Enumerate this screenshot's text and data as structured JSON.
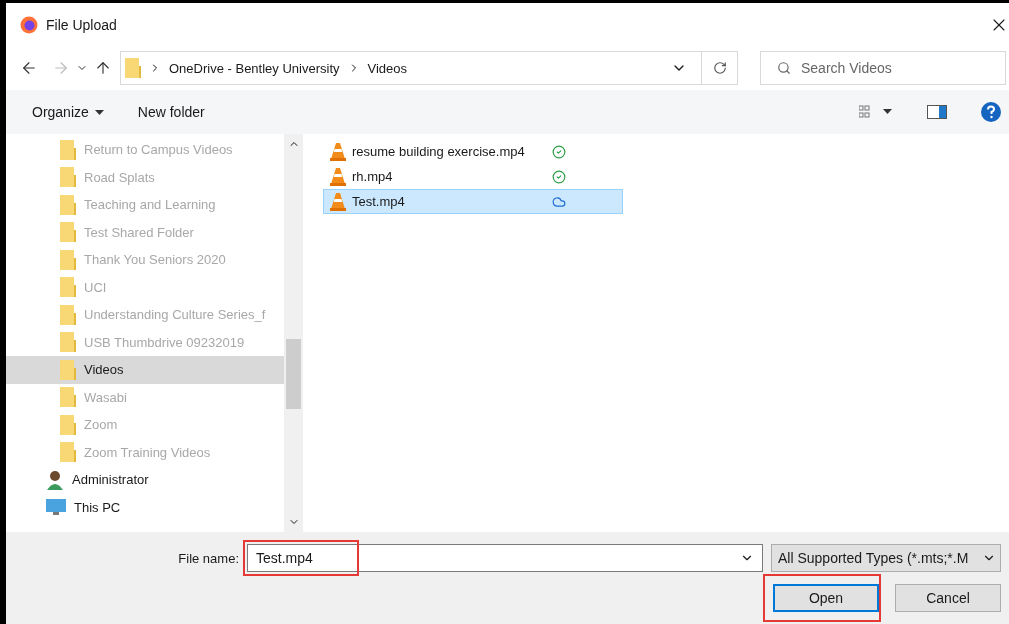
{
  "window": {
    "title": "File Upload"
  },
  "address": {
    "crumbs": [
      "OneDrive - Bentley University",
      "Videos"
    ]
  },
  "search": {
    "placeholder": "Search Videos"
  },
  "toolbar": {
    "organize": "Organize",
    "new_folder": "New folder"
  },
  "sidebar": {
    "items": [
      {
        "label": "Return to Campus Videos",
        "kind": "folder",
        "selected": false,
        "dimmed": true
      },
      {
        "label": "Road Splats",
        "kind": "folder",
        "selected": false,
        "dimmed": true
      },
      {
        "label": "Teaching and Learning",
        "kind": "folder",
        "selected": false,
        "dimmed": true
      },
      {
        "label": "Test Shared Folder",
        "kind": "folder",
        "selected": false,
        "dimmed": true
      },
      {
        "label": "Thank You Seniors 2020",
        "kind": "folder",
        "selected": false,
        "dimmed": true
      },
      {
        "label": "UCI",
        "kind": "folder",
        "selected": false,
        "dimmed": true
      },
      {
        "label": "Understanding Culture Series_f",
        "kind": "folder",
        "selected": false,
        "dimmed": true
      },
      {
        "label": "USB Thumbdrive 09232019",
        "kind": "folder",
        "selected": false,
        "dimmed": true
      },
      {
        "label": "Videos",
        "kind": "folder",
        "selected": true,
        "dimmed": false
      },
      {
        "label": "Wasabi",
        "kind": "folder",
        "selected": false,
        "dimmed": true
      },
      {
        "label": "Zoom",
        "kind": "folder",
        "selected": false,
        "dimmed": true
      },
      {
        "label": "Zoom Training Videos",
        "kind": "folder",
        "selected": false,
        "dimmed": true
      },
      {
        "label": "Administrator",
        "kind": "user",
        "selected": false,
        "dimmed": false
      },
      {
        "label": "This PC",
        "kind": "pc",
        "selected": false,
        "dimmed": false
      }
    ]
  },
  "files": [
    {
      "name": "resume building exercise.mp4",
      "kind": "synced",
      "selected": false
    },
    {
      "name": "rh.mp4",
      "kind": "synced",
      "selected": false
    },
    {
      "name": "Test.mp4",
      "kind": "cloud",
      "selected": true
    }
  ],
  "footer": {
    "file_name_label": "File name:",
    "file_name": "Test.mp4",
    "file_name_highlighted": true,
    "type_filter": "All Supported Types (*.mts;*.M",
    "open": "Open",
    "open_highlighted": true,
    "cancel": "Cancel"
  }
}
